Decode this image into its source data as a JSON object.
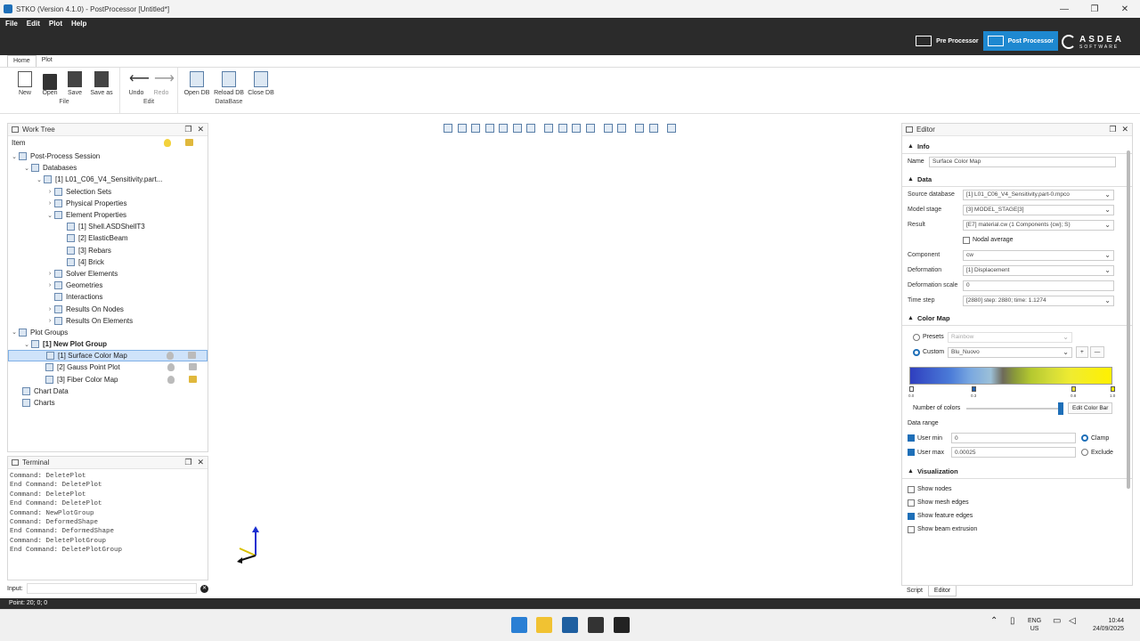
{
  "window": {
    "title": "STKO (Version 4.1.0) - PostProcessor [Untitled*]",
    "minimize": "—",
    "maximize": "❐",
    "close": "✕"
  },
  "menu": [
    "File",
    "Edit",
    "Plot",
    "Help"
  ],
  "modes": {
    "pre": "Pre Processor",
    "post": "Post Processor"
  },
  "logo": {
    "brand": "ASDEA",
    "sub": "SOFTWARE"
  },
  "ribbon": {
    "tabs": [
      "Home",
      "Plot"
    ],
    "file": {
      "label": "File",
      "buttons": [
        "New",
        "Open",
        "Save",
        "Save as"
      ]
    },
    "edit": {
      "label": "Edit",
      "buttons": [
        "Undo",
        "Redo"
      ]
    },
    "database": {
      "label": "DataBase",
      "buttons": [
        "Open DB",
        "Reload DB",
        "Close DB"
      ]
    }
  },
  "worktree": {
    "title": "Work Tree",
    "column": "Item",
    "nodes": [
      {
        "label": "Post-Process Session"
      },
      {
        "label": "Databases"
      },
      {
        "label": "[1] L01_C06_V4_Sensitivity.part..."
      },
      {
        "label": "Selection Sets"
      },
      {
        "label": "Physical Properties"
      },
      {
        "label": "Element Properties"
      },
      {
        "label": "[1] Shell.ASDShellT3"
      },
      {
        "label": "[2] ElasticBeam"
      },
      {
        "label": "[3] Rebars"
      },
      {
        "label": "[4] Brick"
      },
      {
        "label": "Solver Elements"
      },
      {
        "label": "Geometries"
      },
      {
        "label": "Interactions"
      },
      {
        "label": "Results On Nodes"
      },
      {
        "label": "Results On Elements"
      },
      {
        "label": "Plot Groups"
      },
      {
        "label": "[1] New Plot Group"
      },
      {
        "label": "[1] Surface Color Map"
      },
      {
        "label": "[2] Gauss Point Plot"
      },
      {
        "label": "[3] Fiber Color Map"
      },
      {
        "label": "Chart Data"
      },
      {
        "label": "Charts"
      }
    ]
  },
  "terminal": {
    "title": "Terminal",
    "lines": [
      "Command: DeletePlot",
      "End Command: DeletePlot",
      "Command: DeletePlot",
      "End Command: DeletePlot",
      "Command: NewPlotGroup",
      "Command: DeformedShape",
      "End Command: DeformedShape",
      "Command: DeletePlotGroup",
      "End Command: DeletePlotGroup"
    ],
    "input_label": "Input:"
  },
  "editor": {
    "title": "Editor",
    "info": {
      "header": "Info",
      "name_label": "Name",
      "name_value": "Surface Color Map"
    },
    "data": {
      "header": "Data",
      "source_label": "Source database",
      "source_value": "[1] L01_C06_V4_Sensitivity.part-0.mpco",
      "stage_label": "Model stage",
      "stage_value": "[3] MODEL_STAGE[3]",
      "result_label": "Result",
      "result_value": "[E7] material.cw (1 Components {cw}; S)",
      "nodal_label": "Nodal average",
      "component_label": "Component",
      "component_value": "cw",
      "deformation_label": "Deformation",
      "deformation_value": "[1] Displacement",
      "scale_label": "Deformation scale",
      "scale_value": "0",
      "timestep_label": "Time step",
      "timestep_value": "[2880] step: 2880; time: 1.1274"
    },
    "colormap": {
      "header": "Color Map",
      "presets_label": "Presets",
      "presets_value": "Rainbow",
      "custom_label": "Custom",
      "custom_value": "Blu_Nuovo",
      "add": "+",
      "remove": "—",
      "ticks": [
        "0.0",
        "0.3",
        "0.8",
        "1.0"
      ],
      "ncolors_label": "Number of colors",
      "edit_bar": "Edit Color Bar",
      "range_label": "Data range",
      "usermin_label": "User min",
      "usermin_value": "0",
      "usermax_label": "User max",
      "usermax_value": "0.00025",
      "clamp_label": "Clamp",
      "exclude_label": "Exclude"
    },
    "visualization": {
      "header": "Visualization",
      "show_nodes": "Show nodes",
      "show_mesh": "Show mesh edges",
      "show_feature": "Show feature edges",
      "show_beam": "Show beam extrusion"
    },
    "bottom_tabs": [
      "Script",
      "Editor"
    ]
  },
  "status": "Point: 20; 0; 0",
  "taskbar": {
    "lang1": "ENG",
    "lang2": "US",
    "time": "10:44",
    "date": "24/09/2025"
  },
  "colors": {
    "accent": "#1e88d0",
    "dark": "#2b2b2b"
  }
}
